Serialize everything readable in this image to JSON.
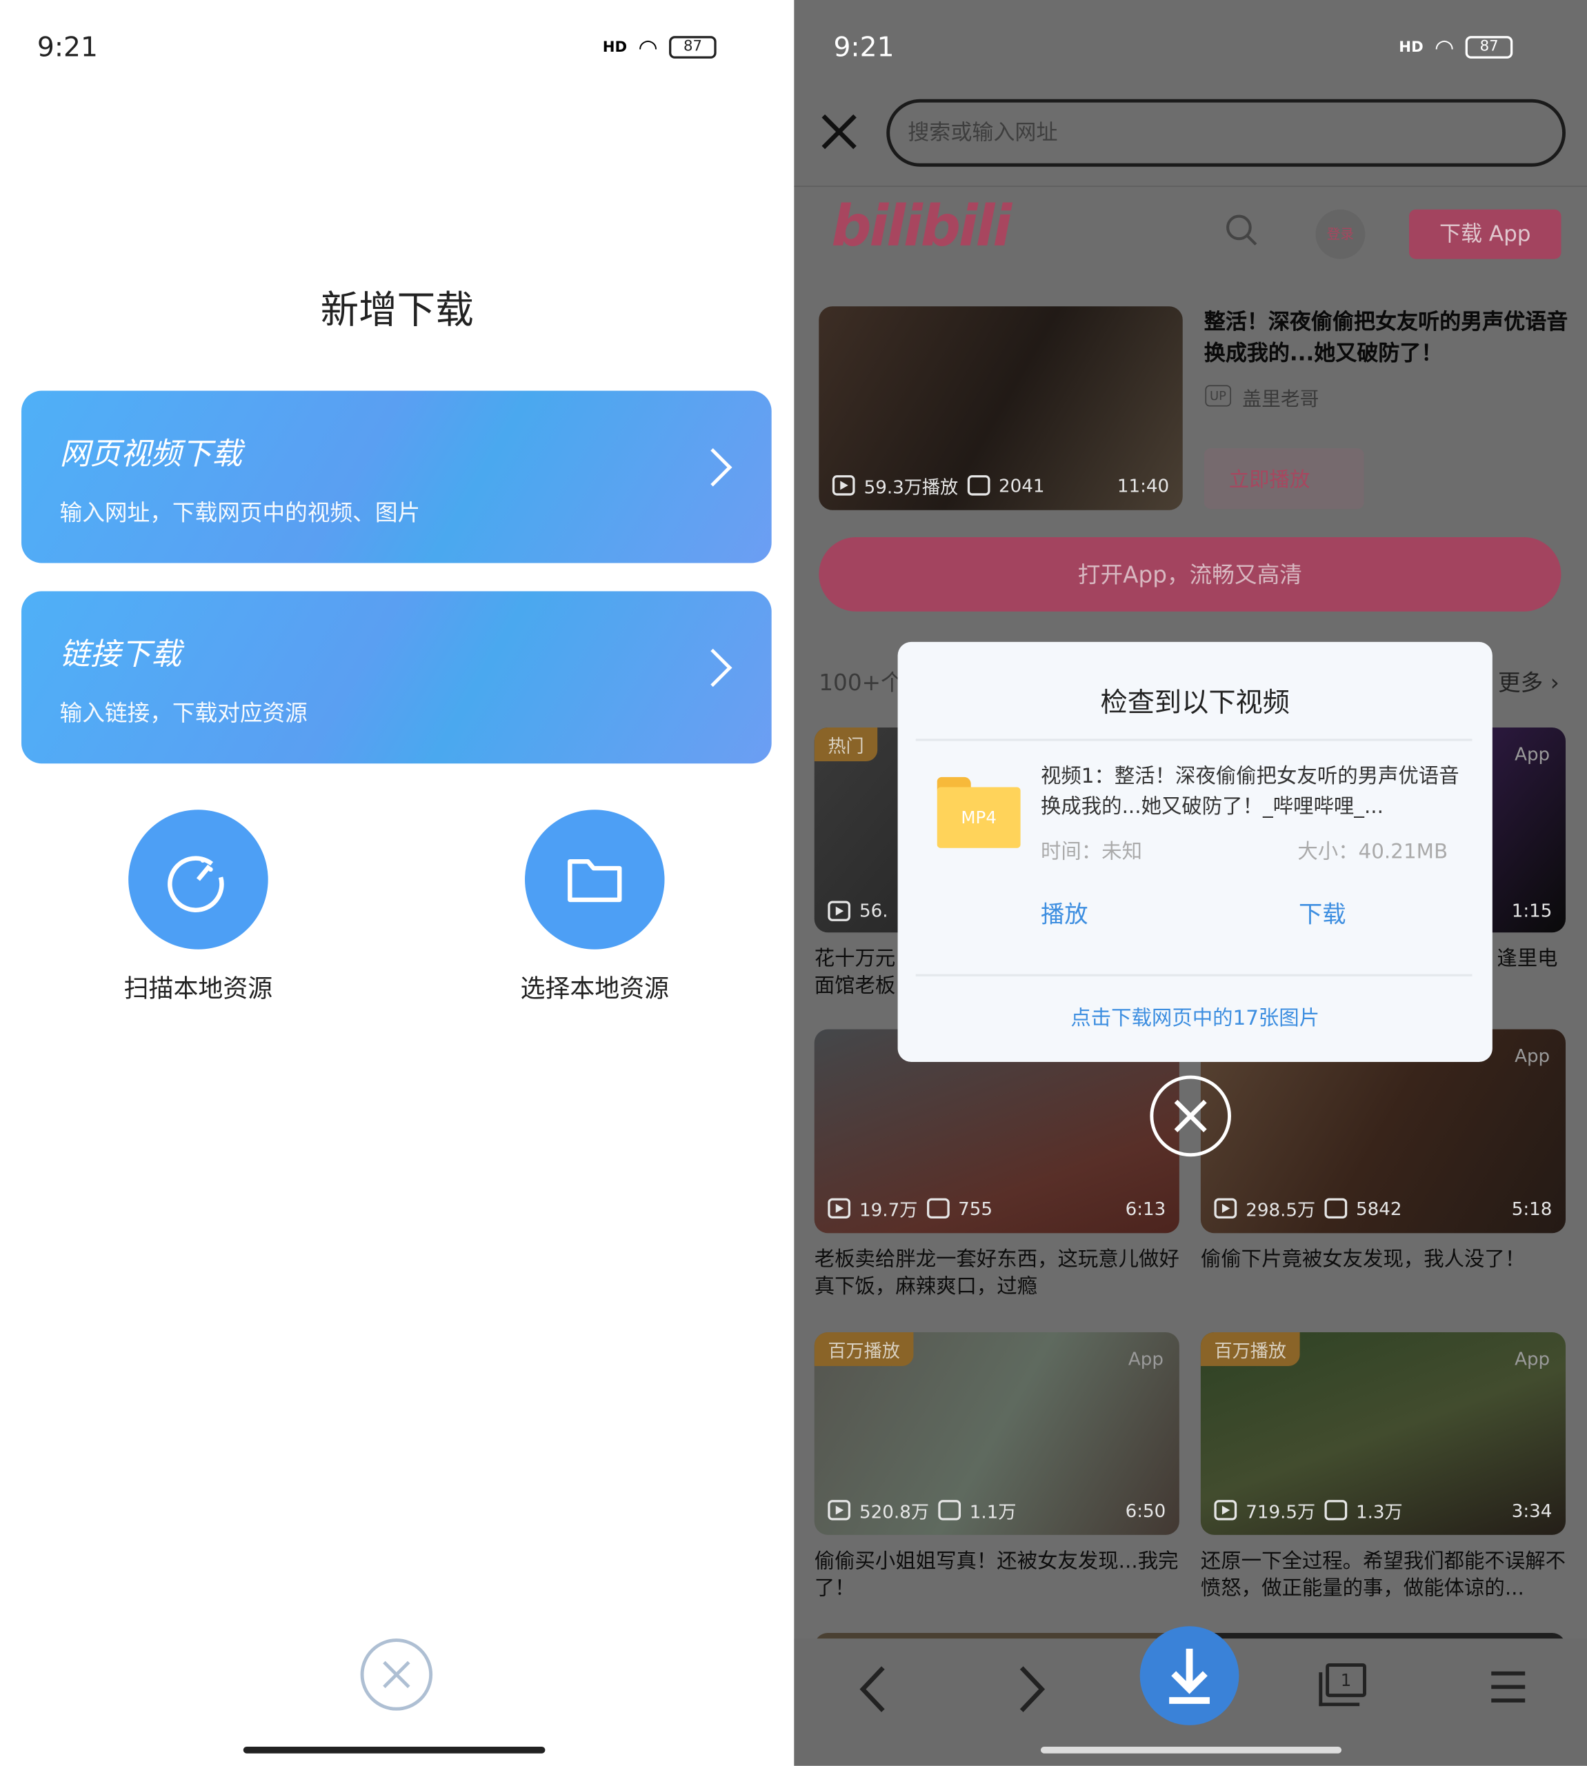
{
  "left": {
    "status": {
      "time": "9:21",
      "signal": "HD",
      "battery": "87"
    },
    "title": "新增下载",
    "cards": [
      {
        "title": "网页视频下载",
        "subtitle": "输入网址，下载网页中的视频、图片"
      },
      {
        "title": "链接下载",
        "subtitle": "输入链接，下载对应资源"
      }
    ],
    "actions": [
      {
        "label": "扫描本地资源",
        "icon": "scan-icon"
      },
      {
        "label": "选择本地资源",
        "icon": "folder-icon"
      }
    ],
    "close_icon": "close-circle-icon"
  },
  "right": {
    "status": {
      "time": "9:21",
      "signal": "HD",
      "battery": "87"
    },
    "search": {
      "placeholder": "搜索或输入网址"
    },
    "site": {
      "logo": "bilibili",
      "login": "登录",
      "download_app": "下载 App",
      "featured": {
        "title": "整活！深夜偷偷把女友听的男声优语音换成我的...她又破防了！",
        "up": "盖里老哥",
        "up_badge": "UP",
        "views": "59.3万播放",
        "danmaku": "2041",
        "duration": "11:40",
        "play_now": "立即播放"
      },
      "open_app": "打开App，流畅又高清",
      "section_left": "100+个",
      "section_more": "更多",
      "videos": [
        {
          "badge": "热门",
          "views": "56.",
          "duration": "",
          "title": "花十万元",
          "title2": "面馆老板"
        },
        {
          "app": "App",
          "duration": "1:15",
          "title": "逢里电"
        },
        {
          "views": "19.7万",
          "danmaku": "755",
          "duration": "6:13",
          "title": "老板卖给胖龙一套好东西，这玩意儿做好真下饭，麻辣爽口，过瘾"
        },
        {
          "app": "App",
          "views": "298.5万",
          "danmaku": "5842",
          "duration": "5:18",
          "title": "偷偷下片竟被女友发现，我人没了！"
        },
        {
          "badge": "百万播放",
          "app": "App",
          "views": "520.8万",
          "danmaku": "1.1万",
          "duration": "6:50",
          "title": "偷偷买小姐姐写真！还被女友发现...我完了！"
        },
        {
          "badge": "百万播放",
          "app": "App",
          "views": "719.5万",
          "danmaku": "1.3万",
          "duration": "3:34",
          "title": "还原一下全过程。希望我们都能不误解不愤怒，做正能量的事，做能体谅的..."
        }
      ],
      "accent": "#fb7299"
    },
    "dialog": {
      "title": "检查到以下视频",
      "file_type": "MP4",
      "video_name": "视频1：整活！深夜偷偷把女友听的男声优语音换成我的...她又破防了！_哔哩哔哩_...",
      "time": "时间：未知",
      "size": "大小：40.21MB",
      "play": "播放",
      "download": "下载",
      "images_link": "点击下载网页中的17张图片"
    },
    "bottom_nav": {
      "tab_count": "1"
    }
  }
}
